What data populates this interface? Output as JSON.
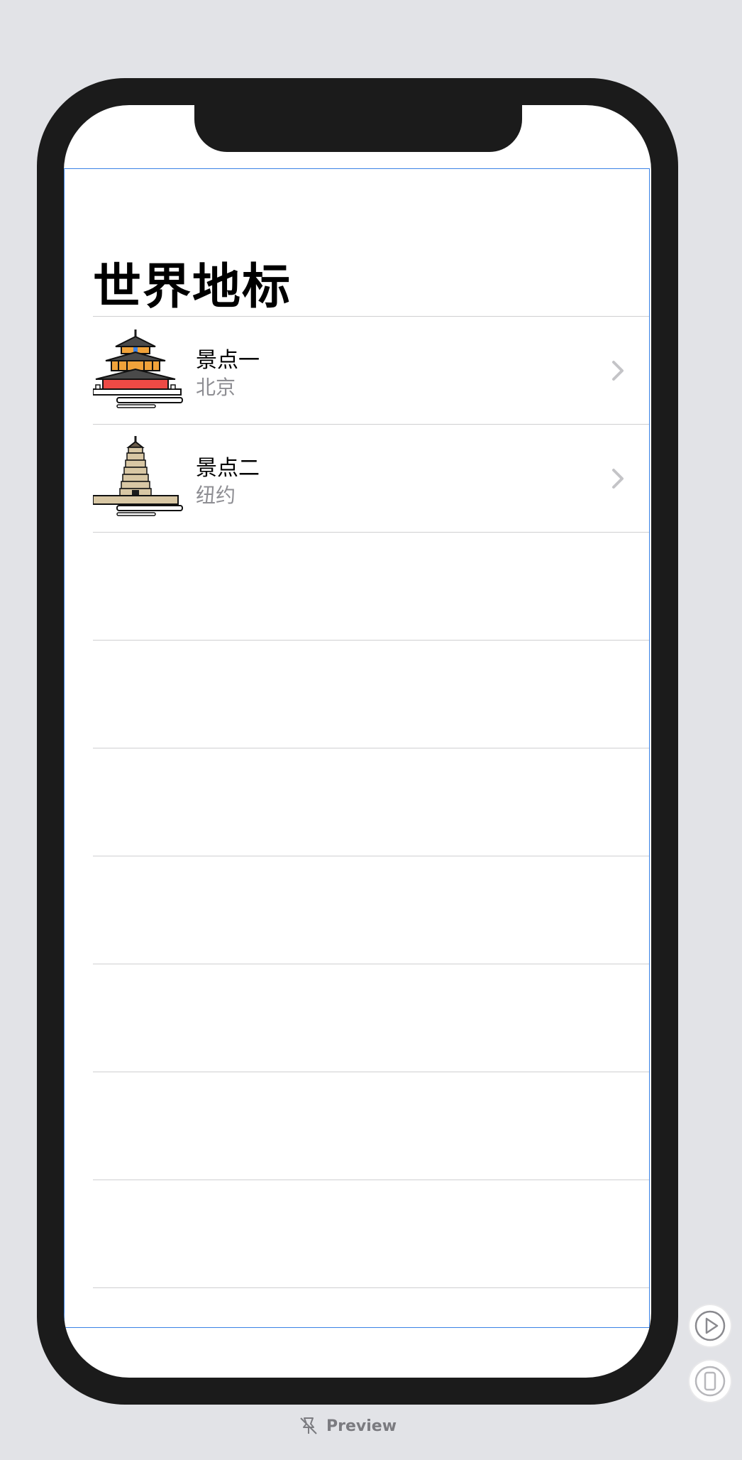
{
  "nav": {
    "title": "世界地标"
  },
  "landmarks": [
    {
      "name": "景点一",
      "city": "北京",
      "icon": "temple-of-heaven-icon"
    },
    {
      "name": "景点二",
      "city": "纽约",
      "icon": "pagoda-icon"
    }
  ],
  "footer": {
    "preview_label": "Preview"
  },
  "colors": {
    "accent": "#3a82e6",
    "separator": "#cfcfd1",
    "secondary_text": "#8e8e93"
  }
}
